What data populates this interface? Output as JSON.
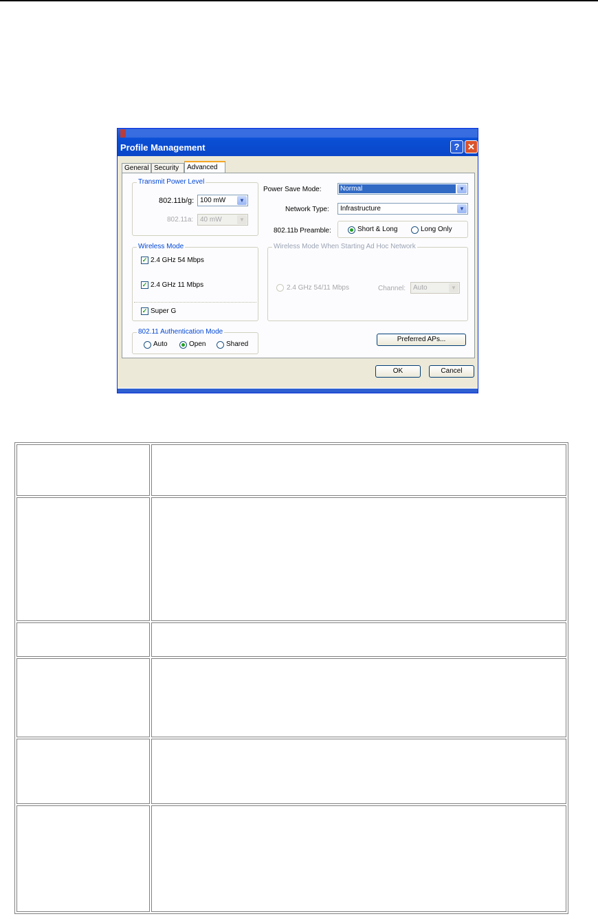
{
  "dialog": {
    "title": "Profile Management",
    "help_icon": "question-mark-icon",
    "close_icon": "x-icon",
    "tabs": [
      {
        "label": "General"
      },
      {
        "label": "Security"
      },
      {
        "label": "Advanced"
      }
    ],
    "transmit_power": {
      "legend": "Transmit Power Level",
      "bg_label": "802.11b/g:",
      "bg_value": "100 mW",
      "a_label": "802.11a:",
      "a_value": "40 mW"
    },
    "wireless_mode": {
      "legend": "Wireless Mode",
      "opt1": "2.4 GHz 54 Mbps",
      "opt2": "2.4 GHz 11 Mbps",
      "opt3": "Super G",
      "opt1_checked": true,
      "opt2_checked": true,
      "opt3_checked": true
    },
    "auth_mode": {
      "legend": "802.11 Authentication Mode",
      "auto": "Auto",
      "open": "Open",
      "shared": "Shared",
      "selected": "Open"
    },
    "power_save": {
      "label": "Power Save Mode:",
      "value": "Normal"
    },
    "network_type": {
      "label": "Network Type:",
      "value": "Infrastructure"
    },
    "preamble": {
      "label": "802.11b Preamble:",
      "short_long": "Short & Long",
      "long_only": "Long Only",
      "selected": "Short & Long"
    },
    "adhoc": {
      "legend": "Wireless Mode When Starting Ad Hoc Network",
      "mode_label": "2.4 GHz 54/11 Mbps",
      "channel_label": "Channel:",
      "channel_value": "Auto"
    },
    "preferred_aps": "Preferred APs...",
    "ok": "OK",
    "cancel": "Cancel",
    "check_mark": "✓",
    "dropdown_arrow": "▼"
  },
  "table": {
    "rows": [
      {
        "label": "",
        "text": ""
      },
      {
        "label": "",
        "text": ""
      },
      {
        "label": "",
        "text": ""
      },
      {
        "label": "",
        "text": ""
      },
      {
        "label": "",
        "text": ""
      },
      {
        "label": "",
        "text": ""
      }
    ]
  }
}
